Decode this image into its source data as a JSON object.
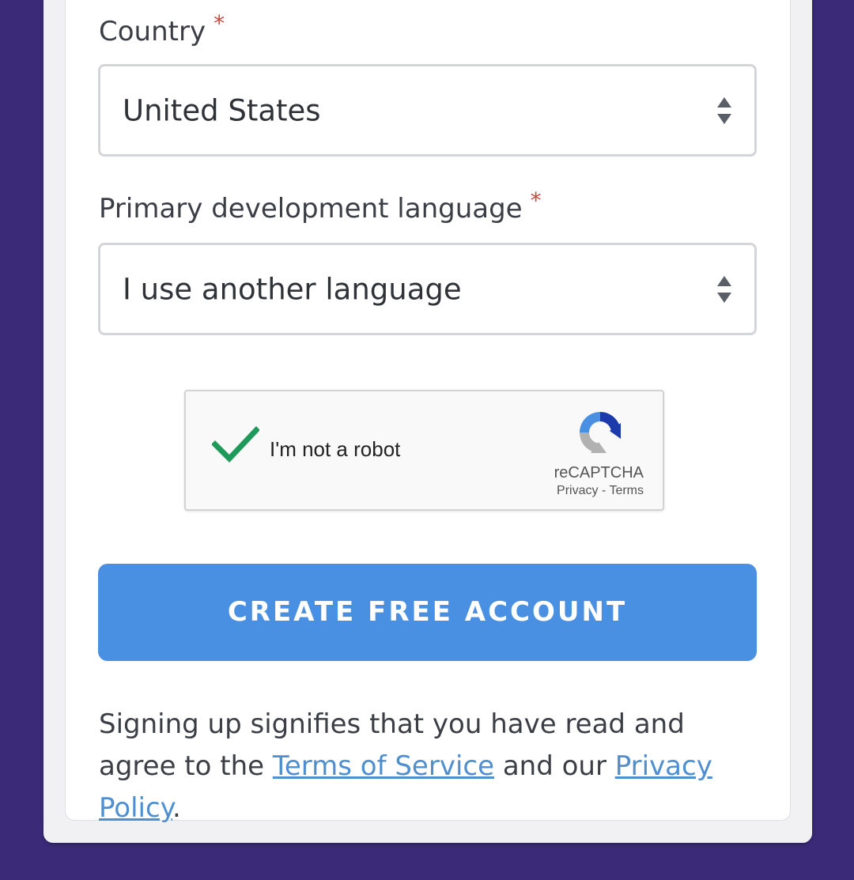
{
  "form": {
    "country": {
      "label": "Country",
      "required_mark": "*",
      "value": "United States"
    },
    "language": {
      "label": "Primary development language",
      "required_mark": "*",
      "value": "I use another language"
    },
    "recaptcha": {
      "checkbox_label": "I'm not a robot",
      "checked": true,
      "brand": "reCAPTCHA",
      "privacy_link": "Privacy",
      "separator": " - ",
      "terms_link": "Terms"
    },
    "submit": {
      "label": "CREATE FREE ACCOUNT"
    },
    "legal": {
      "prefix": "Signing up signifies that you have read and agree to the ",
      "terms_link": "Terms of Service",
      "middle": " and our ",
      "privacy_link": "Privacy Policy",
      "suffix": "."
    }
  },
  "colors": {
    "page_background": "#3a2a78",
    "button_primary": "#4a90e2",
    "link": "#4f8fd0",
    "required_star": "#c9463d",
    "check_green": "#1e9a5a"
  }
}
